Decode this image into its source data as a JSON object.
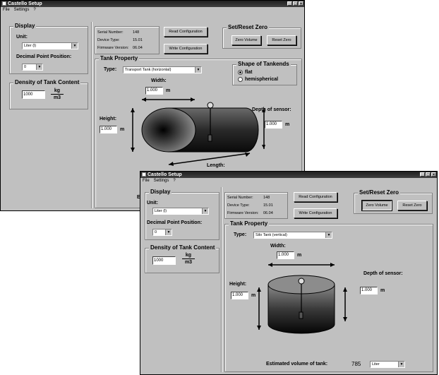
{
  "window1": {
    "title": "Castello Setup",
    "menu": [
      "File",
      "Settings",
      "?"
    ],
    "controls": [
      "_",
      "□",
      "×"
    ],
    "display": {
      "title": "Display",
      "unit_label": "Unit:",
      "unit_value": "Liter (l)",
      "decimal_label": "Decimal Point Position:",
      "decimal_value": "0"
    },
    "density": {
      "title": "Density of Tank Content",
      "value": "1000",
      "unit_top": "kg",
      "unit_bottom": "m3"
    },
    "device_info": {
      "serial_label": "Serial Number:",
      "serial_value": "148",
      "type_label": "Device Type:",
      "type_value": "15.01",
      "firmware_label": "Firmware Version:",
      "firmware_value": "06.04"
    },
    "read_button": "Read Configuration",
    "write_button": "Write Configuration",
    "zero": {
      "title": "Set/Reset Zero",
      "zero_volume": "Zero Volume",
      "reset_zero": "Reset Zero"
    },
    "tank": {
      "title": "Tank Property",
      "type_label": "Type:",
      "type_value": "Transport Tank (horizontal)",
      "width_label": "Width:",
      "width_value": "1.000",
      "height_label": "Height:",
      "height_value": "1.000",
      "depth_label": "Depth of sensor:",
      "depth_value": "1.000",
      "length_label": "Length:",
      "unit": "m",
      "partial_label": "E"
    },
    "shape": {
      "title": "Shape of Tankends",
      "options": [
        "flat",
        "hemispherical"
      ],
      "selected": 0
    }
  },
  "window2": {
    "title": "Castello Setup",
    "menu": [
      "File",
      "Settings",
      "?"
    ],
    "controls": [
      "_",
      "□",
      "×"
    ],
    "display": {
      "title": "Display",
      "unit_label": "Unit:",
      "unit_value": "Liter (l)",
      "decimal_label": "Decimal Point Position:",
      "decimal_value": "0"
    },
    "density": {
      "title": "Density of Tank Content",
      "value": "1000",
      "unit_top": "kg",
      "unit_bottom": "m3"
    },
    "device_info": {
      "serial_label": "Serial Number:",
      "serial_value": "148",
      "type_label": "Device Type:",
      "type_value": "15.01",
      "firmware_label": "Firmware Version:",
      "firmware_value": "06.04"
    },
    "read_button": "Read Configuration",
    "write_button": "Write Configuration",
    "zero": {
      "title": "Set/Reset Zero",
      "zero_volume": "Zero Volume",
      "reset_zero": "Reset Zero"
    },
    "tank": {
      "title": "Tank Property",
      "type_label": "Type:",
      "type_value": "Silo Tank (vertical)",
      "width_label": "Width:",
      "width_value": "1.000",
      "height_label": "Height:",
      "height_value": "1.000",
      "depth_label": "Depth of sensor:",
      "depth_value": "1.000",
      "unit": "m",
      "volume_label": "Estimated volume of tank:",
      "volume_value": "785",
      "volume_unit": "Liter"
    }
  }
}
